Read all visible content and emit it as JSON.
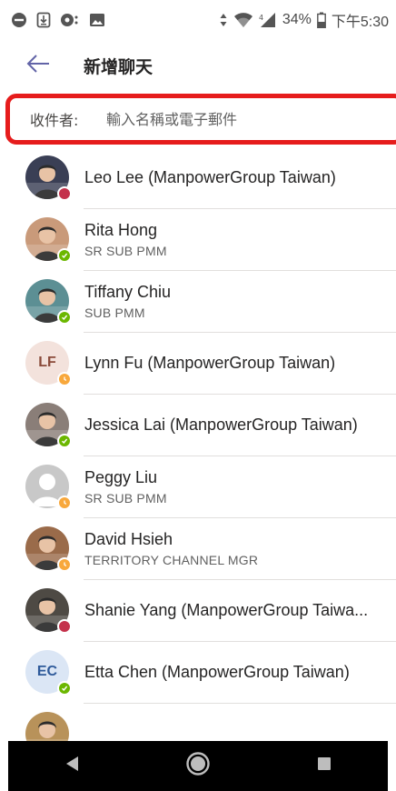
{
  "status_bar": {
    "battery": "34%",
    "time": "下午5:30"
  },
  "header": {
    "title": "新增聊天"
  },
  "to_field": {
    "label": "收件者:",
    "placeholder": "輸入名稱或電子郵件"
  },
  "contacts": [
    {
      "name": "Leo Lee (ManpowerGroup Taiwan)",
      "subtitle": "",
      "presence": "busy",
      "avatar": "photo",
      "avatar_color": "#3a3f55"
    },
    {
      "name": "Rita Hong",
      "subtitle": "SR SUB PMM",
      "presence": "available",
      "avatar": "photo",
      "avatar_color": "#c99a7a"
    },
    {
      "name": "Tiffany Chiu",
      "subtitle": "SUB PMM",
      "presence": "available",
      "avatar": "photo",
      "avatar_color": "#5c8f94"
    },
    {
      "name": "Lynn Fu (ManpowerGroup Taiwan)",
      "subtitle": "",
      "presence": "away",
      "avatar": "initials",
      "initials": "LF",
      "avatar_color": "#f3e2dc",
      "initials_color": "#8a4a3a"
    },
    {
      "name": "Jessica Lai (ManpowerGroup Taiwan)",
      "subtitle": "",
      "presence": "available",
      "avatar": "photo",
      "avatar_color": "#8a7e78"
    },
    {
      "name": "Peggy Liu",
      "subtitle": "SR SUB PMM",
      "presence": "away",
      "avatar": "placeholder",
      "avatar_color": "#c8c8c8"
    },
    {
      "name": "David Hsieh",
      "subtitle": "TERRITORY CHANNEL MGR",
      "presence": "away",
      "avatar": "photo",
      "avatar_color": "#9a6b4a"
    },
    {
      "name": "Shanie Yang (ManpowerGroup Taiwa...",
      "subtitle": "",
      "presence": "busy",
      "avatar": "photo",
      "avatar_color": "#4e4a44"
    },
    {
      "name": "Etta Chen (ManpowerGroup Taiwan)",
      "subtitle": "",
      "presence": "available",
      "avatar": "initials",
      "initials": "EC",
      "avatar_color": "#dbe6f5",
      "initials_color": "#2e5a9a"
    },
    {
      "name": "",
      "subtitle": "",
      "presence": "",
      "avatar": "photo",
      "avatar_color": "#b8925a"
    }
  ],
  "colors": {
    "accent": "#6264a7",
    "busy": "#c4314b",
    "available": "#6bb700",
    "away": "#f8a83c",
    "highlight_border": "#e61c1c"
  },
  "icons": {
    "back": "arrow-left-icon",
    "nav_back": "triangle-back-icon",
    "nav_home": "circle-home-icon",
    "nav_recents": "square-recents-icon"
  }
}
